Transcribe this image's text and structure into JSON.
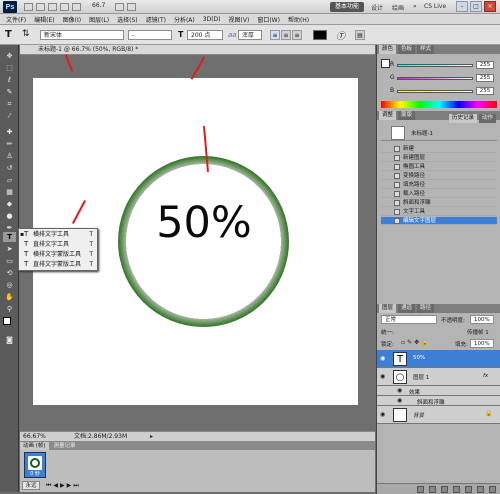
{
  "app": {
    "logo": "Ps",
    "zoom": "66.7",
    "workspace_active": "基本功能",
    "workspace_others": [
      "设计",
      "绘画"
    ],
    "cs_live": "CS Live"
  },
  "menu": [
    "文件(F)",
    "编辑(E)",
    "图像(I)",
    "图层(L)",
    "选择(S)",
    "滤镜(T)",
    "分析(A)",
    "3D(D)",
    "视图(V)",
    "窗口(W)",
    "帮助(H)"
  ],
  "options": {
    "tool_glyph": "T",
    "font_family": "新宋体",
    "font_style": "-",
    "size_glyph": "T",
    "font_size": "200 点",
    "aa_label": "aa",
    "aa_mode": "浑厚"
  },
  "document": {
    "tab_title": "未标题-1 @ 66.7% (50%, RGB/8) *",
    "text": "50%",
    "status_zoom": "66.67%",
    "status_doc": "文档:2.86M/2.93M"
  },
  "flyout": {
    "items": [
      {
        "icon": "T",
        "label": "横排文字工具",
        "key": "T",
        "active": true
      },
      {
        "icon": "T",
        "label": "直排文字工具",
        "key": "T",
        "active": false
      },
      {
        "icon": "T",
        "label": "横排文字蒙版工具",
        "key": "T",
        "active": false
      },
      {
        "icon": "T",
        "label": "直排文字蒙版工具",
        "key": "T",
        "active": false
      }
    ]
  },
  "animation": {
    "tabs": [
      "动画 (帧)",
      "测量记录"
    ],
    "frame_label": "0 秒",
    "loop": "永远"
  },
  "panels": {
    "color_tabs": [
      "颜色",
      "色板",
      "样式"
    ],
    "color": [
      {
        "label": "R",
        "value": "255"
      },
      {
        "label": "G",
        "value": "255"
      },
      {
        "label": "B",
        "value": "255"
      }
    ],
    "adjust_tabs": [
      "调整",
      "蒙版"
    ],
    "history_tabs": [
      "历史记录",
      "动作"
    ],
    "history_snapshot": "未标题-1",
    "history": [
      "新建",
      "新建图层",
      "椭圆工具",
      "变换路径",
      "填充路径",
      "载入路径",
      "斜面和浮雕",
      "文字工具",
      "编辑文字图层"
    ],
    "history_selected": 8,
    "layers_tabs": [
      "图层",
      "通道",
      "路径"
    ],
    "blend": "正常",
    "opacity_label": "不透明度:",
    "opacity": "100%",
    "unify_label": "统一:",
    "propagate": "传播帧 1",
    "lock_label": "锁定:",
    "fill_label": "填充:",
    "fill": "100%",
    "layers": [
      {
        "thumb": "T",
        "name": "50%",
        "selected": true,
        "fx": false
      },
      {
        "thumb": "○",
        "name": "图层 1",
        "selected": false,
        "fx": true
      },
      {
        "thumb": "",
        "name": "效果",
        "selected": false,
        "sub": true
      },
      {
        "thumb": "",
        "name": "斜面和浮雕",
        "selected": false,
        "sub": true
      },
      {
        "thumb": "",
        "name": "背景",
        "selected": false,
        "fx": false
      }
    ]
  },
  "colors": {
    "ring": "#1e5f1a",
    "selection": "#3d7fd4",
    "arrow": "#e21b1b"
  }
}
